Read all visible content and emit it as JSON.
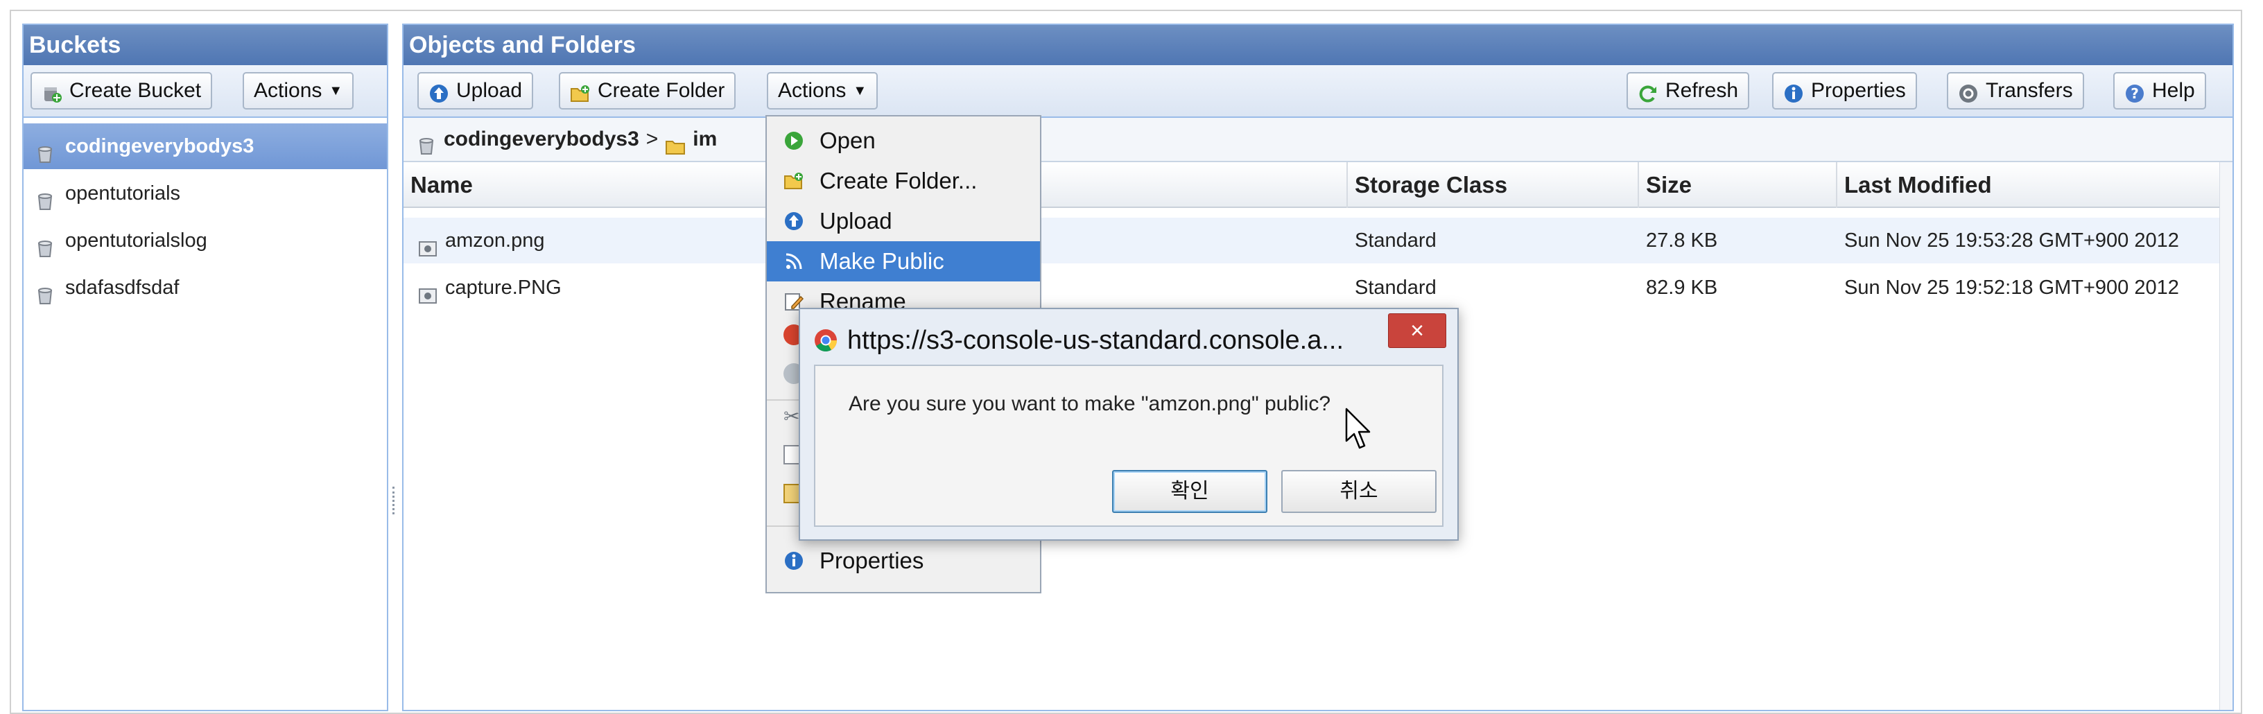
{
  "buckets_panel": {
    "title": "Buckets",
    "create_bucket_label": "Create Bucket",
    "actions_label": "Actions",
    "items": [
      {
        "label": "codingeverybodys3",
        "selected": true
      },
      {
        "label": "opentutorials",
        "selected": false
      },
      {
        "label": "opentutorialslog",
        "selected": false
      },
      {
        "label": "sdafasdfsdaf",
        "selected": false
      }
    ]
  },
  "objects_panel": {
    "title": "Objects and Folders",
    "toolbar": {
      "upload_label": "Upload",
      "create_folder_label": "Create Folder",
      "actions_label": "Actions",
      "refresh_label": "Refresh",
      "properties_label": "Properties",
      "transfers_label": "Transfers",
      "help_label": "Help"
    },
    "breadcrumb": {
      "bucket": "codingeverybodys3",
      "separator": ">",
      "folder": "im"
    },
    "columns": {
      "name": "Name",
      "storage_class": "Storage Class",
      "size": "Size",
      "last_modified": "Last Modified"
    },
    "rows": [
      {
        "name": "amzon.png",
        "storage_class": "Standard",
        "size": "27.8 KB",
        "last_modified": "Sun Nov 25 19:53:28 GMT+900 2012"
      },
      {
        "name": "capture.PNG",
        "storage_class": "Standard",
        "size": "82.9 KB",
        "last_modified": "Sun Nov 25 19:52:18 GMT+900 2012"
      }
    ]
  },
  "context_menu": {
    "items": [
      {
        "label": "Open",
        "icon": "open-icon"
      },
      {
        "label": "Create Folder...",
        "icon": "create-folder-icon"
      },
      {
        "label": "Upload",
        "icon": "upload-icon"
      },
      {
        "label": "Make Public",
        "icon": "make-public-icon",
        "active": true
      },
      {
        "label": "Rename",
        "icon": "rename-icon"
      }
    ],
    "bottom_item": {
      "label": "Properties",
      "icon": "info-icon"
    }
  },
  "dialog": {
    "title": "https://s3-console-us-standard.console.a...",
    "close_label": "×",
    "message": "Are you sure you want to make \"amzon.png\" public?",
    "ok_label": "확인",
    "cancel_label": "취소"
  },
  "colors": {
    "panel_header": "#4f76b3",
    "selected_row": "#7097d6",
    "menu_highlight": "#3f7fd1",
    "dialog_close": "#c9443c"
  }
}
